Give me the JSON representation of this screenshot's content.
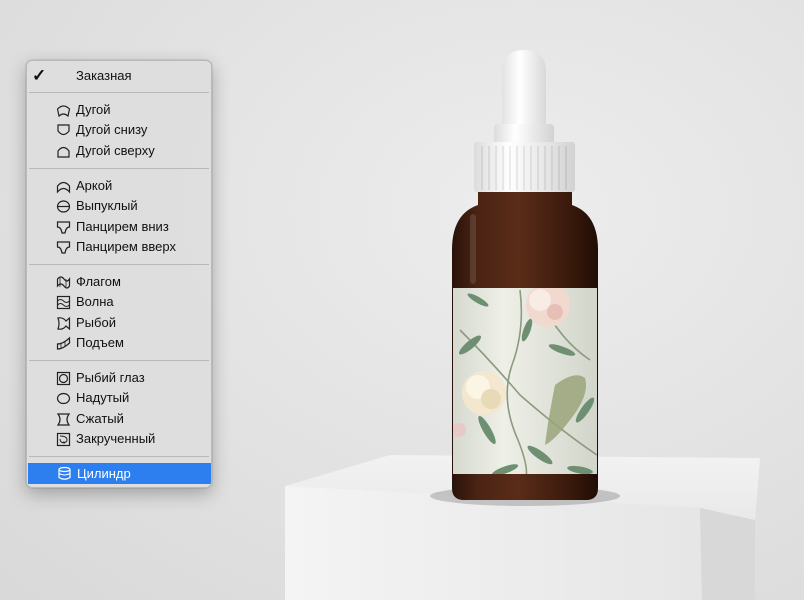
{
  "menu": {
    "current": "Заказная",
    "groups": [
      [
        {
          "label": "Дугой",
          "icon": "arc-icon"
        },
        {
          "label": "Дугой снизу",
          "icon": "arc-lower-icon"
        },
        {
          "label": "Дугой сверху",
          "icon": "arc-upper-icon"
        }
      ],
      [
        {
          "label": "Аркой",
          "icon": "arch-icon"
        },
        {
          "label": "Выпуклый",
          "icon": "bulge-icon"
        },
        {
          "label": "Панцирем вниз",
          "icon": "shell-lower-icon"
        },
        {
          "label": "Панцирем вверх",
          "icon": "shell-upper-icon"
        }
      ],
      [
        {
          "label": "Флагом",
          "icon": "flag-icon"
        },
        {
          "label": "Волна",
          "icon": "wave-icon"
        },
        {
          "label": "Рыбой",
          "icon": "fish-icon"
        },
        {
          "label": "Подъем",
          "icon": "rise-icon"
        }
      ],
      [
        {
          "label": "Рыбий глаз",
          "icon": "fisheye-icon"
        },
        {
          "label": "Надутый",
          "icon": "inflate-icon"
        },
        {
          "label": "Сжатый",
          "icon": "squeeze-icon"
        },
        {
          "label": "Закрученный",
          "icon": "twist-icon"
        }
      ],
      [
        {
          "label": "Цилиндр",
          "icon": "cylinder-icon",
          "selected": true
        }
      ]
    ]
  },
  "colors": {
    "highlight": "#2d7ff0",
    "background": "#e4e4e4",
    "bottle_glass": "#4a2313",
    "cap": "#f4f4f4",
    "label_paper": "#e9ece1"
  }
}
